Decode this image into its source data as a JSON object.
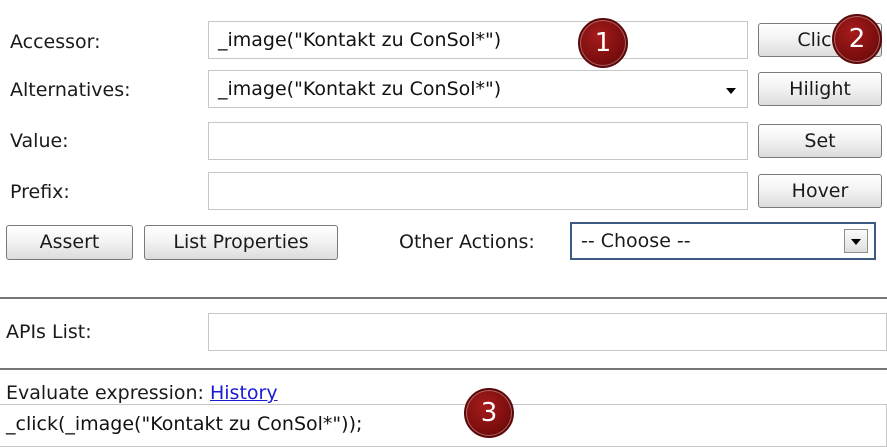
{
  "accessor": {
    "label": "Accessor:",
    "value": "_image(\"Kontakt zu ConSol*\")",
    "button": "Click"
  },
  "alternatives": {
    "label": "Alternatives:",
    "value": "_image(\"Kontakt zu ConSol*\")",
    "button": "Hilight"
  },
  "value_row": {
    "label": "Value:",
    "value": "",
    "button": "Set"
  },
  "prefix_row": {
    "label": "Prefix:",
    "value": "",
    "button": "Hover"
  },
  "actions": {
    "assert": "Assert",
    "list_properties": "List Properties",
    "other_actions_label": "Other Actions:",
    "other_actions_selected": "-- Choose --"
  },
  "apis": {
    "label": "APIs List:",
    "value": ""
  },
  "evaluate": {
    "label": "Evaluate expression:",
    "history_link": "History",
    "expression": "_click(_image(\"Kontakt zu ConSol*\"));"
  },
  "callouts": [
    "1",
    "2",
    "3"
  ],
  "colors": {
    "callout": "#7d0e0e",
    "link": "#1a1ad6",
    "select_border": "#3d5a82"
  },
  "icons": {
    "dropdown": "chevron-down-icon"
  }
}
